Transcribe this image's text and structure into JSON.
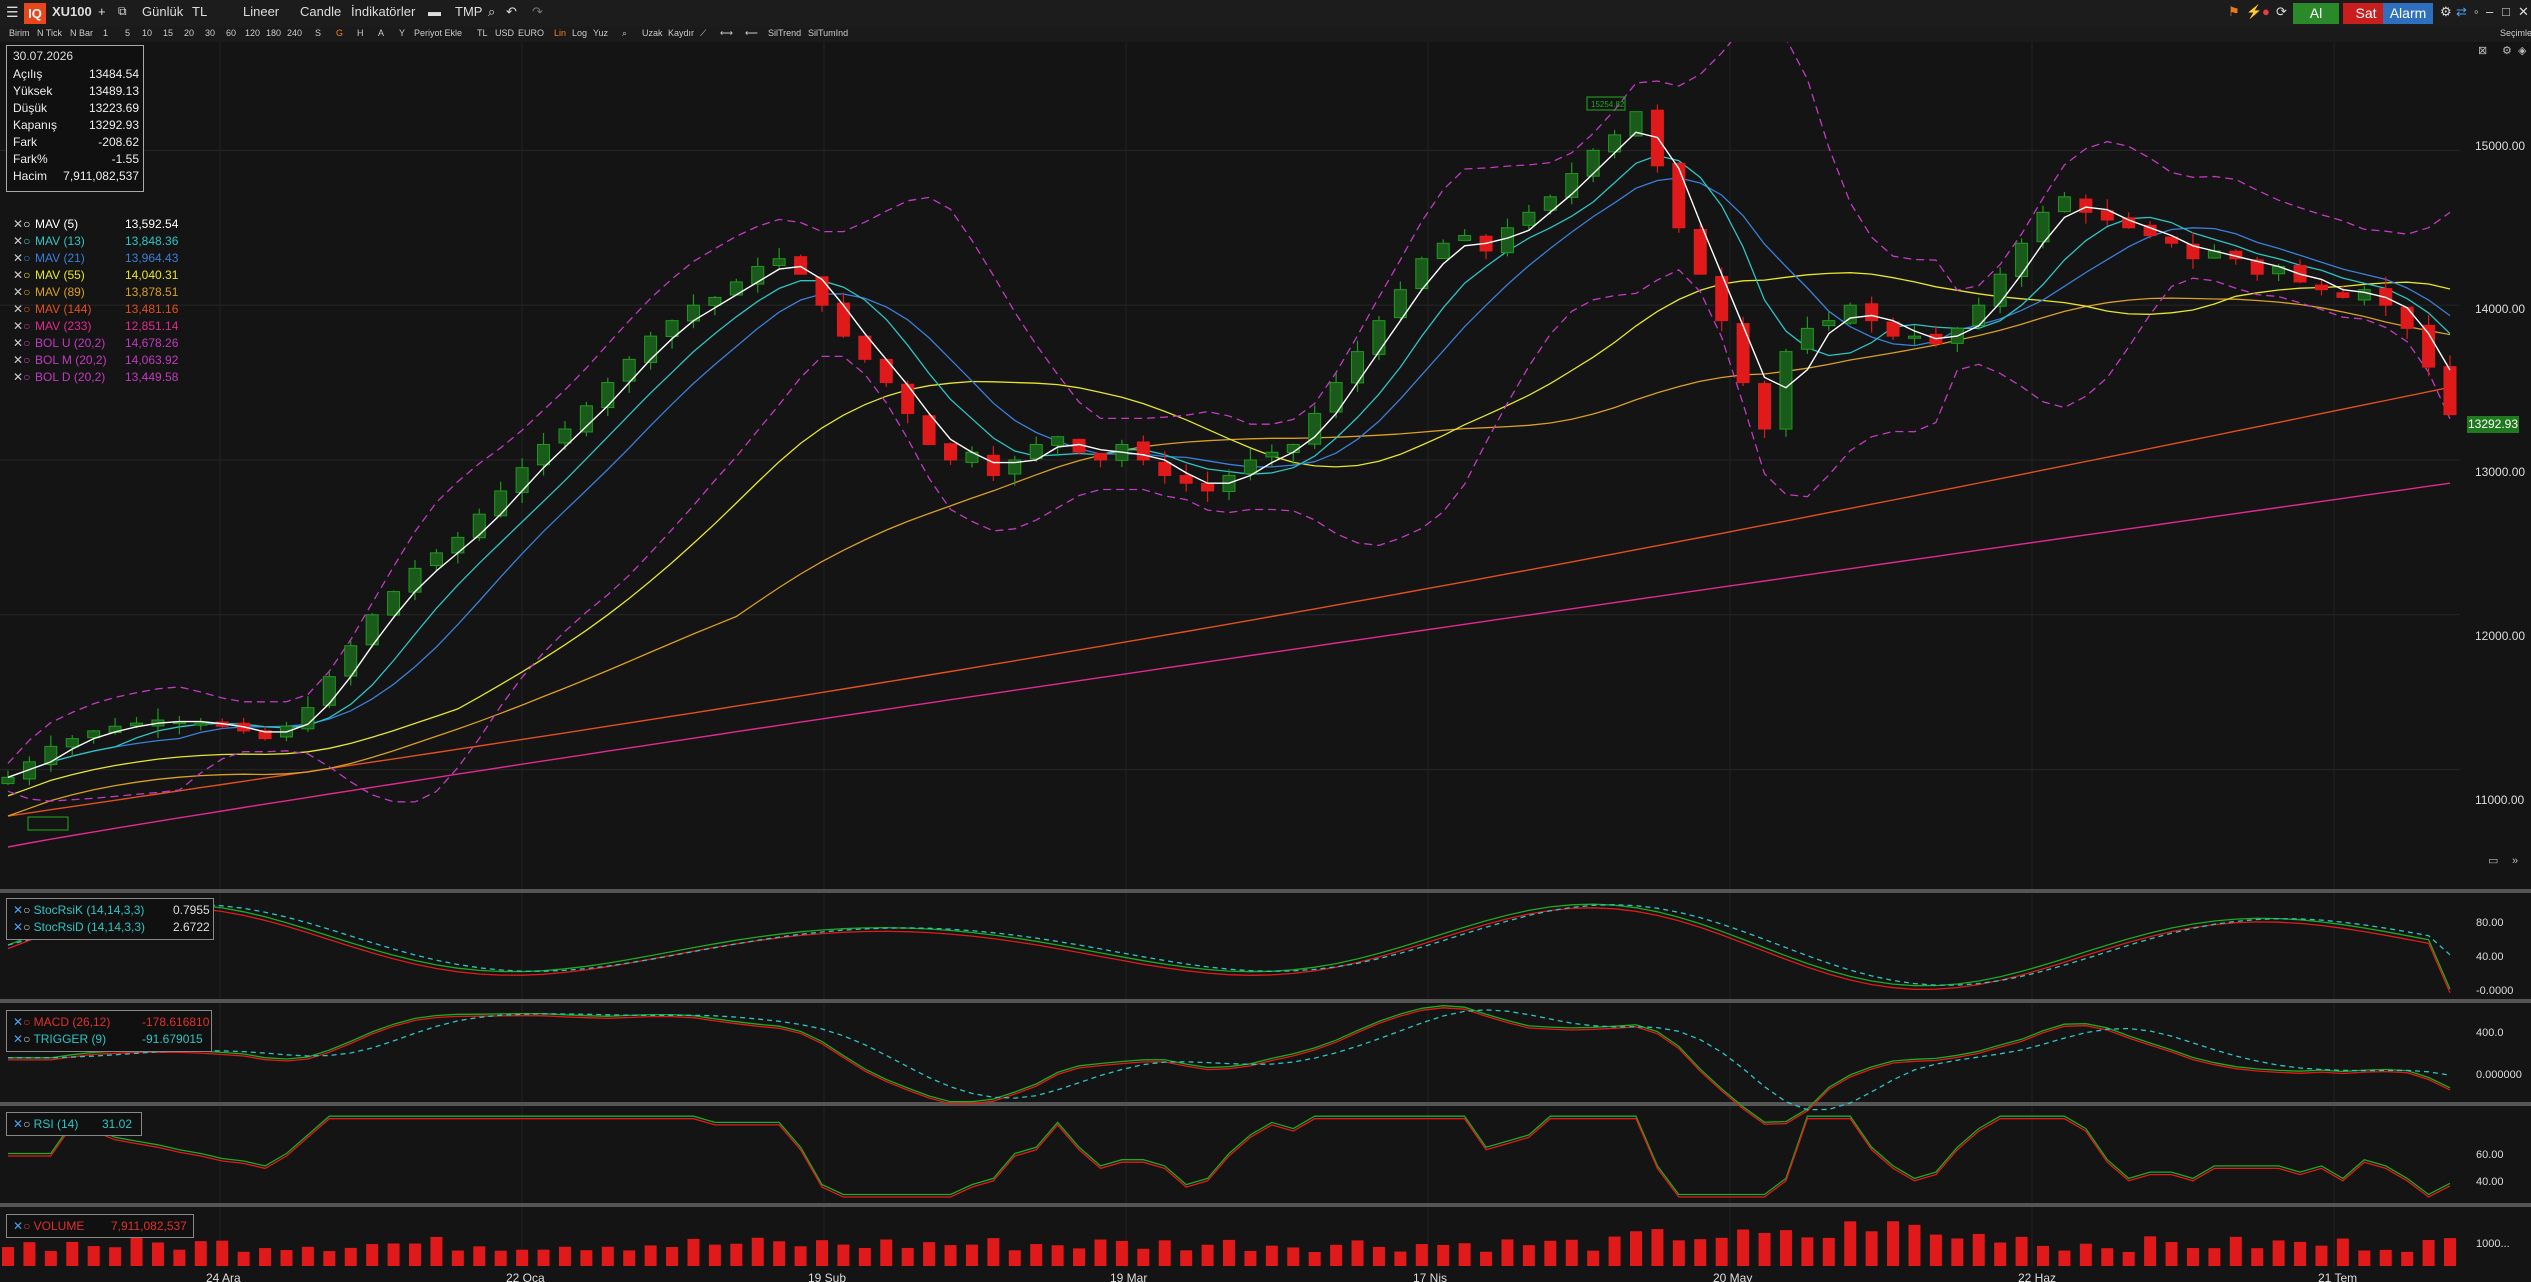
{
  "toolbar": {
    "logo": "IQ",
    "symbol": "XU100",
    "plus": "+",
    "period": "Günlük",
    "currency": "TL",
    "scale": "Lineer",
    "chart_type": "Candle",
    "indicators": "İndikatörler",
    "tmp": "TMP",
    "buy": "Al",
    "sell": "Sat",
    "alarm": "Alarm"
  },
  "toolbar2": {
    "items": [
      "Birim",
      "N Tick",
      "N Bar",
      "1",
      "5",
      "10",
      "15",
      "20",
      "30",
      "60",
      "120",
      "180",
      "240",
      "S",
      "G",
      "H",
      "A",
      "Y",
      "Periyot Ekle",
      "TL",
      "USD",
      "EURO",
      "Lin",
      "Log",
      "Yuz",
      "Uzak",
      "Kaydır",
      "SilTrend",
      "SilTumInd"
    ]
  },
  "info": {
    "date": "30.07.2026",
    "rows": [
      {
        "k": "Açılış",
        "v": "13484.54"
      },
      {
        "k": "Yüksek",
        "v": "13489.13"
      },
      {
        "k": "Düşük",
        "v": "13223.69"
      },
      {
        "k": "Kapanış",
        "v": "13292.93"
      },
      {
        "k": "Fark",
        "v": "-208.62"
      },
      {
        "k": "Fark%",
        "v": "-1.55"
      },
      {
        "k": "Hacim",
        "v": "7,911,082,537"
      }
    ]
  },
  "legend": [
    {
      "name": "MAV (5)",
      "value": "13,592.54",
      "color": "#ffffff"
    },
    {
      "name": "MAV (13)",
      "value": "13,848.36",
      "color": "#2ec4c4"
    },
    {
      "name": "MAV (21)",
      "value": "13,964.43",
      "color": "#3a7fd9"
    },
    {
      "name": "MAV (55)",
      "value": "14,040.31",
      "color": "#e6e62a"
    },
    {
      "name": "MAV (89)",
      "value": "13,878.51",
      "color": "#d9a020"
    },
    {
      "name": "MAV (144)",
      "value": "13,481.16",
      "color": "#e0501e"
    },
    {
      "name": "MAV (233)",
      "value": "12,851.14",
      "color": "#e02a90"
    },
    {
      "name": "BOL U (20,2)",
      "value": "14,678.26",
      "color": "#c23ac2"
    },
    {
      "name": "BOL M (20,2)",
      "value": "14,063.92",
      "color": "#c23ac2"
    },
    {
      "name": "BOL D (20,2)",
      "value": "13,449.58",
      "color": "#c23ac2"
    }
  ],
  "price_axis": [
    "15000.00",
    "14000.00",
    "13000.00",
    "12000.00",
    "11000.00"
  ],
  "last_price": "13292.93",
  "annotation_high": "15254.82",
  "x_axis": [
    "24 Ara",
    "22 Oca",
    "19 Şub",
    "19 Mar",
    "17 Nis",
    "20 May",
    "22 Haz",
    "21 Tem"
  ],
  "stoch": {
    "k_label": "StocRsiK (14,14,3,3)",
    "k_value": "0.7955",
    "d_label": "StocRsiD (14,14,3,3)",
    "d_value": "2.6722",
    "axis": [
      "80.00",
      "40.00",
      "-0.0000"
    ]
  },
  "macd": {
    "macd_label": "MACD (26,12)",
    "macd_value": "-178.616810",
    "trig_label": "TRIGGER (9)",
    "trig_value": "-91.679015",
    "axis": [
      "400.0",
      "0.000000"
    ]
  },
  "rsi": {
    "label": "RSI (14)",
    "value": "31.02",
    "axis": [
      "60.00",
      "40.00"
    ]
  },
  "volume": {
    "label": "VOLUME",
    "value": "7,911,082,537",
    "axis": [
      "1000..."
    ]
  },
  "right_label": "Seçimle",
  "chart_data": {
    "type": "candlestick",
    "symbol": "XU100",
    "ylim": [
      10500,
      15700
    ],
    "closes_approx": [
      10950,
      11050,
      11150,
      11200,
      11250,
      11280,
      11300,
      11320,
      11310,
      11300,
      11280,
      11250,
      11200,
      11280,
      11400,
      11600,
      11800,
      12000,
      12150,
      12300,
      12400,
      12500,
      12650,
      12800,
      12950,
      13100,
      13200,
      13350,
      13500,
      13650,
      13800,
      13900,
      14000,
      14050,
      14150,
      14250,
      14300,
      14200,
      14000,
      13800,
      13650,
      13500,
      13300,
      13100,
      13000,
      13050,
      12900,
      13000,
      13100,
      13150,
      13050,
      13000,
      13100,
      13000,
      12900,
      12850,
      12800,
      12900,
      13000,
      13050,
      13100,
      13300,
      13500,
      13700,
      13900,
      14100,
      14300,
      14400,
      14450,
      14350,
      14500,
      14600,
      14700,
      14850,
      15000,
      15100,
      15250,
      14900,
      14500,
      14200,
      13900,
      13500,
      13200,
      13700,
      13850,
      13900,
      14000,
      13900,
      13800,
      13800,
      13750,
      13850,
      14000,
      14200,
      14400,
      14600,
      14700,
      14600,
      14550,
      14500,
      14450,
      14400,
      14300,
      14350,
      14300,
      14200,
      14250,
      14150,
      14100,
      14050,
      14100,
      14000,
      13850,
      13600,
      13292.93
    ]
  }
}
